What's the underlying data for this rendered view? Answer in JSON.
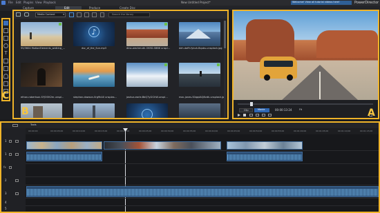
{
  "titlebar": {
    "menus": [
      "File",
      "Edit",
      "Plugins",
      "View",
      "Playback"
    ],
    "title": "New Untitled Project*",
    "notification": "Welcome! View all tutorial videos here!",
    "app_name": "PowerDirector"
  },
  "tabs": [
    "Capture",
    "Edit",
    "Produce",
    "Create Disc"
  ],
  "active_tab": "Edit",
  "library": {
    "filter_label": "Media Content",
    "search_placeholder": "Search the library",
    "items": [
      {
        "label": "55/3604 MotionElements_walking_..."
      },
      {
        "label": "dsc_of_the_Sun.mp3"
      },
      {
        "label": "dino-wechmuth-O65D-SBB6 unspl..."
      },
      {
        "label": "deh-daffr-fybuh-Bqubs-unsplash.jpg"
      },
      {
        "label": "ethan-robertson-SYJOOK2m-unspl..."
      },
      {
        "label": "stephan-dawson-0rg9hA0 unsplas..."
      },
      {
        "label": "joshua-earle-BbQ7yl2ChW-unspl..."
      },
      {
        "label": "mac-jones-S0qqdAQ8vdk-unsplash.jpg"
      },
      {
        "label": ""
      },
      {
        "label": ""
      },
      {
        "label": ""
      },
      {
        "label": ""
      }
    ]
  },
  "preview": {
    "clip_label": "Clip",
    "movie_label": "Movie",
    "timecode": "00:00:13:24",
    "zoom": "Fit"
  },
  "timeline": {
    "tools_label": "Tools",
    "ruler_ticks": [
      "00:00:00",
      "00:00:05;00",
      "00:00:10;00",
      "00:00:15;00",
      "00:00:20;00",
      "00:00:25;00",
      "00:00:30;00",
      "00:00:35;00",
      "00:00:40;00",
      "00:00:45;00",
      "00:00:50;00",
      "00:00:55;00",
      "00:01:00;00",
      "00:01:05;00",
      "00:01:10;00",
      "00:01:15;00"
    ],
    "track_numbers": [
      "1",
      "1",
      "2",
      "3",
      "4",
      "5"
    ]
  },
  "callouts": {
    "a": "A",
    "b": "B",
    "c": "C"
  },
  "colors": {
    "highlight": "#f0b429",
    "clip": "#2c4d73",
    "audio": "#6fb3e6",
    "check": "#6cc04a"
  }
}
